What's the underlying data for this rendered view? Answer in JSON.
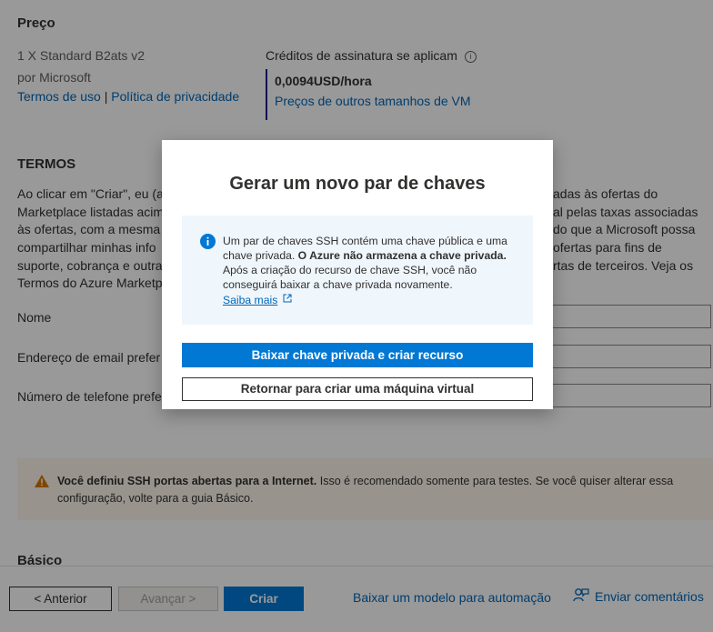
{
  "price": {
    "heading": "Preço",
    "product": "1 X Standard B2ats v2",
    "publisher": "por Microsoft",
    "terms_link": "Termos de uso",
    "separator": "|",
    "privacy_link": "Política de privacidade",
    "credits_label": "Créditos de assinatura se aplicam",
    "amount": "0,0094USD/hora",
    "other_sizes_link": "Preços de outros tamanhos de VM"
  },
  "terms": {
    "heading": "TERMOS",
    "line1_left": "Ao clicar em \"Criar\", eu (a",
    "line1_right": "adas às ofertas do",
    "line2_left": "Marketplace listadas acim",
    "line2_right": "al pelas taxas associadas",
    "line3_left": "às ofertas, com a mesma",
    "line3_right": "do que a Microsoft possa",
    "line4_left": "compartilhar minhas info",
    "line4_right": "ofertas para fins de",
    "line5_left": "suporte, cobrança e outra",
    "line5_right": "rtas de terceiros. Veja os",
    "azure_terms_link": "Termos do Azure Marketp"
  },
  "contact": {
    "name_label": "Nome",
    "email_label": "Endereço de email prefer",
    "phone_label": "Número de telefone prefe"
  },
  "warning": {
    "bold": "Você definiu SSH portas abertas para a Internet.",
    "rest": "Isso é recomendado somente para testes.  Se você quiser alterar essa configuração, volte para a guia Básico."
  },
  "basics_heading": "Básico",
  "footer": {
    "prev": "< Anterior",
    "next": "Avançar >",
    "create": "Criar",
    "download_template": "Baixar um modelo para automação",
    "feedback": "Enviar comentários"
  },
  "modal": {
    "title": "Gerar um novo par de chaves",
    "info_part1": "Um par de chaves SSH contém uma chave pública e uma chave privada.",
    "info_bold": "O Azure não armazena a chave privada.",
    "info_part2": "Após a criação do recurso de chave SSH, você não conseguirá baixar a chave privada novamente.",
    "learn_more": "Saiba mais",
    "primary_button": "Baixar chave privada e criar recurso",
    "secondary_button": "Retornar para criar uma máquina virtual"
  },
  "colors": {
    "accent": "#0078d4",
    "link": "#0067b8",
    "warning_icon": "#d47500",
    "info_bg": "#eff6fc"
  }
}
